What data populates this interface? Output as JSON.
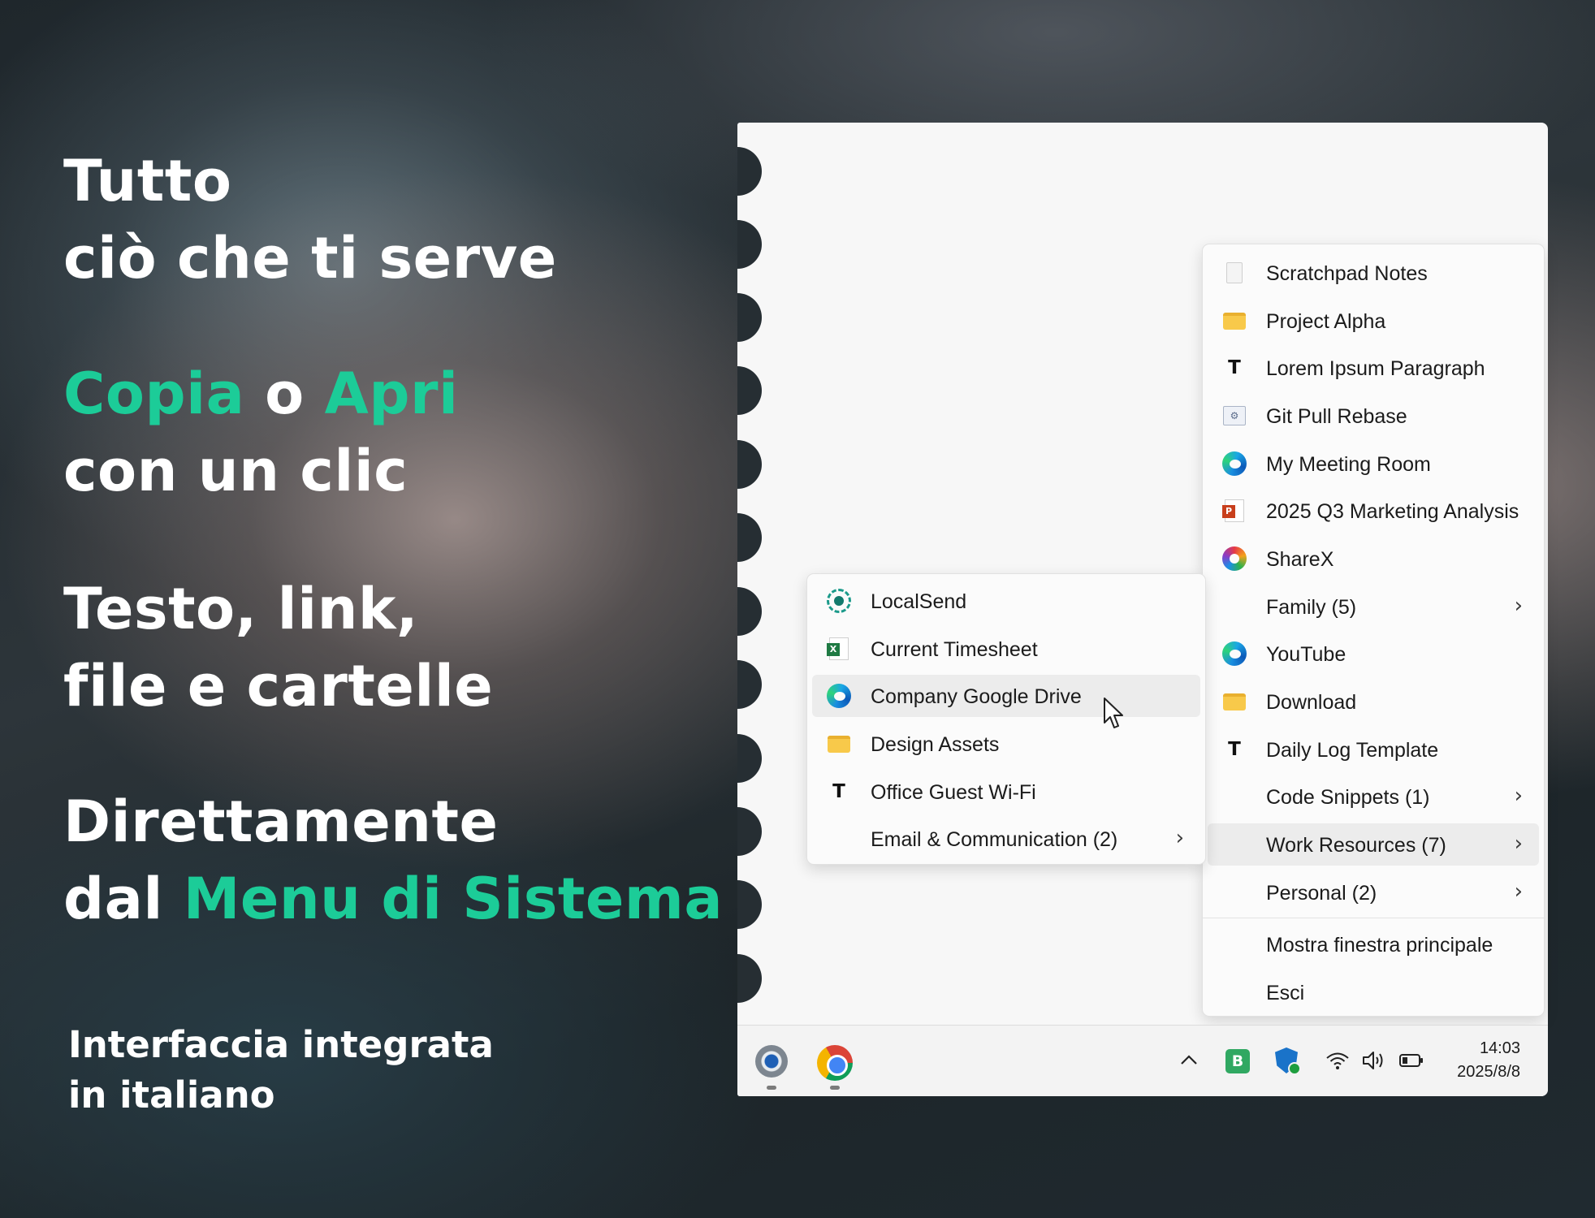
{
  "promo": {
    "line1": "Tutto",
    "line2": "ciò che ti serve",
    "copy": "Copia",
    "or": " o ",
    "open": "Apri",
    "line4": "con un clic",
    "line5": "Testo, link,",
    "line6": "file e cartelle",
    "line7": "Direttamente",
    "line8_prefix": "dal ",
    "line8_accent": "Menu di Sistema",
    "sub1": "Interfaccia integrata",
    "sub2": "in italiano",
    "accent_color": "#1ccc98"
  },
  "main_menu": {
    "items": [
      {
        "label": "Scratchpad Notes",
        "icon": "text-file-icon"
      },
      {
        "label": "Project Alpha",
        "icon": "folder-icon"
      },
      {
        "label": "Lorem Ipsum Paragraph",
        "icon": "text-snippet-icon"
      },
      {
        "label": "Git Pull Rebase",
        "icon": "command-icon"
      },
      {
        "label": "My Meeting Room",
        "icon": "edge-icon"
      },
      {
        "label": "2025 Q3 Marketing Analysis",
        "icon": "powerpoint-icon"
      },
      {
        "label": "ShareX",
        "icon": "sharex-icon"
      },
      {
        "label": "Family  (5)",
        "icon": "",
        "submenu": true
      },
      {
        "label": "YouTube",
        "icon": "edge-icon"
      },
      {
        "label": "Download",
        "icon": "folder-icon"
      },
      {
        "label": "Daily Log Template",
        "icon": "text-snippet-icon"
      },
      {
        "label": "Code Snippets  (1)",
        "icon": "",
        "submenu": true
      },
      {
        "label": "Work Resources  (7)",
        "icon": "",
        "submenu": true,
        "highlighted": true
      },
      {
        "label": "Personal  (2)",
        "icon": "",
        "submenu": true
      }
    ],
    "show_main_window": "Mostra finestra principale",
    "exit": "Esci"
  },
  "sub_menu": {
    "items": [
      {
        "label": "LocalSend",
        "icon": "localsend-icon"
      },
      {
        "label": "Current Timesheet",
        "icon": "excel-icon"
      },
      {
        "label": "Company Google Drive",
        "icon": "edge-icon",
        "highlighted": true
      },
      {
        "label": "Design Assets",
        "icon": "folder-icon"
      },
      {
        "label": "Office Guest Wi-Fi",
        "icon": "text-snippet-icon"
      },
      {
        "label": "Email & Communication  (2)",
        "icon": "",
        "submenu": true
      }
    ]
  },
  "taskbar": {
    "time": "14:03",
    "date": "2025/8/8",
    "tray_badge": "B"
  }
}
